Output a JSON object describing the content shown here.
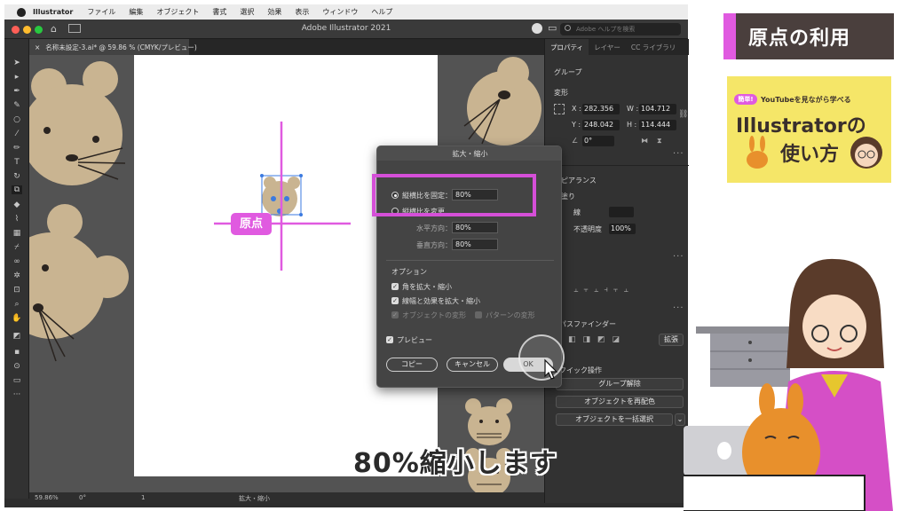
{
  "menubar": {
    "app": "Illustrator",
    "items": [
      "ファイル",
      "編集",
      "オブジェクト",
      "書式",
      "選択",
      "効果",
      "表示",
      "ウィンドウ",
      "ヘルプ"
    ]
  },
  "window": {
    "title": "Adobe Illustrator 2021",
    "search_placeholder": "Adobe ヘルプを検索",
    "doc_tab": "名称未設定-3.ai* @ 59.86 % (CMYK/プレビュー)"
  },
  "statusbar": {
    "zoom": "59.86%",
    "rotation": "0°",
    "artboard_num": "1",
    "tool_name": "拡大・縮小"
  },
  "panel": {
    "tabs": [
      "プロパティ",
      "レイヤー",
      "CC ライブラリ"
    ],
    "group_label": "グループ",
    "transform_label": "変形",
    "x_label": "X :",
    "x_value": "282.356",
    "y_label": "Y :",
    "y_value": "248.042",
    "w_label": "W :",
    "w_value": "104.712",
    "h_label": "H :",
    "h_value": "114.444",
    "angle_value": "0°",
    "appearance_label": "アピアランス",
    "fill_label": "塗り",
    "stroke_label": "線",
    "opacity_label": "不透明度",
    "opacity_value": "100%",
    "pathfinder_label": "パスファインダー",
    "expand_btn": "拡張",
    "quick_actions_label": "クイック操作",
    "ungroup_btn": "グループ解除",
    "recolor_btn": "オブジェクトを再配色",
    "select_same_btn": "オブジェクトを一括選択"
  },
  "dialog": {
    "title": "拡大・縮小",
    "uniform_label": "縦横比を固定：",
    "uniform_value": "80%",
    "nonuniform_label": "縦横比を変更",
    "horizontal_label": "水平方向：",
    "horizontal_value": "80%",
    "vertical_label": "垂直方向：",
    "vertical_value": "80%",
    "options_label": "オプション",
    "scale_corners": "角を拡大・縮小",
    "scale_strokes": "線幅と効果を拡大・縮小",
    "transform_objects": "オブジェクトの変形",
    "transform_patterns": "パターンの変形",
    "preview_label": "プレビュー",
    "copy_btn": "コピー",
    "cancel_btn": "キャンセル",
    "ok_btn": "OK"
  },
  "annotation": {
    "origin_label": "原点",
    "caption": "80%縮小します"
  },
  "branding": {
    "topic": "原点の利用",
    "badge": "簡単!",
    "subtitle": "YouTubeを見ながら学べる",
    "title_line1": "Illustratorの",
    "title_line2": "使い方"
  },
  "colors": {
    "accent_magenta": "#e05ae0",
    "mouse_body": "#c9b491",
    "card_yellow": "#f5e668",
    "card_dark": "#4a3f3d"
  }
}
